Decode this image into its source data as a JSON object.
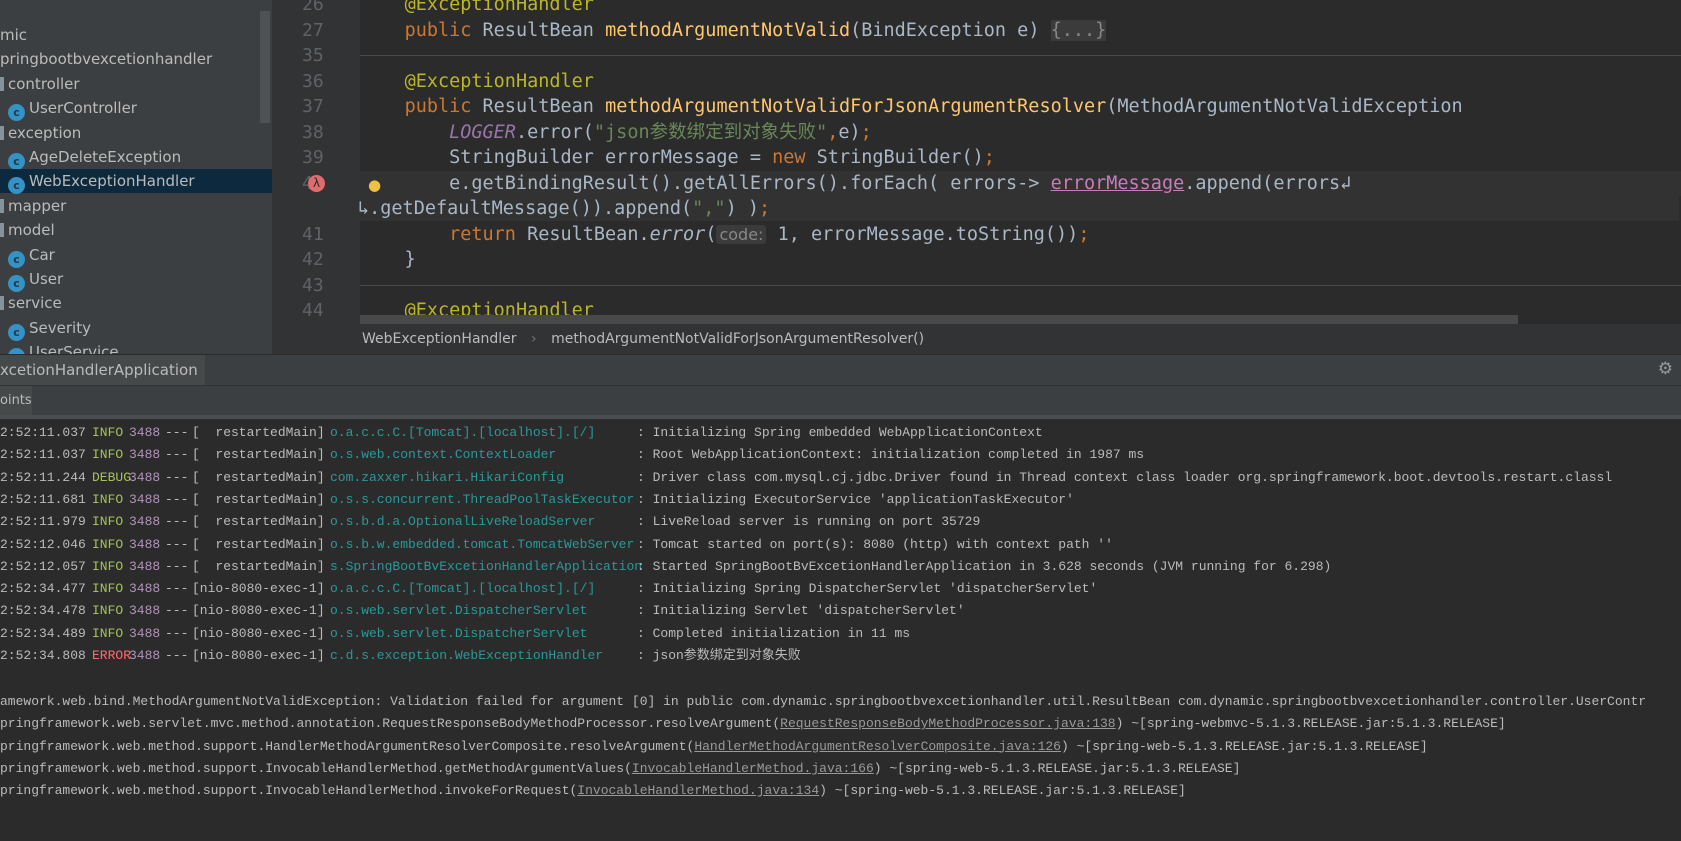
{
  "project_tree": [
    {
      "label": "mic",
      "type": "pkg",
      "indent": 0
    },
    {
      "label": "pringbootbvexcetionhandler",
      "type": "pkg",
      "indent": 0
    },
    {
      "label": "controller",
      "type": "folder",
      "indent": 0
    },
    {
      "label": "UserController",
      "type": "class",
      "indent": 1
    },
    {
      "label": "exception",
      "type": "folder",
      "indent": 0
    },
    {
      "label": "AgeDeleteException",
      "type": "class",
      "indent": 1
    },
    {
      "label": "WebExceptionHandler",
      "type": "class",
      "indent": 1,
      "selected": true
    },
    {
      "label": "mapper",
      "type": "folder",
      "indent": 0
    },
    {
      "label": "model",
      "type": "folder",
      "indent": 0
    },
    {
      "label": "Car",
      "type": "class",
      "indent": 1
    },
    {
      "label": "User",
      "type": "class",
      "indent": 1
    },
    {
      "label": "service",
      "type": "folder",
      "indent": 0
    },
    {
      "label": "Severity",
      "type": "class",
      "indent": 1
    },
    {
      "label": "UserService",
      "type": "class",
      "indent": 1
    }
  ],
  "editor": {
    "lines": [
      {
        "n": "26",
        "tokens": [
          [
            "    "
          ],
          [
            "@ExceptionHandler",
            "an"
          ]
        ]
      },
      {
        "n": "27",
        "tokens": [
          [
            "    "
          ],
          [
            "public ",
            "kw"
          ],
          [
            "ResultBean "
          ],
          [
            "methodArgumentNotValid",
            "fn"
          ],
          [
            "(BindException e) "
          ],
          [
            "{...}",
            "fold"
          ]
        ]
      },
      {
        "n": "35",
        "tokens": [],
        "sep": true
      },
      {
        "n": "36",
        "tokens": [
          [
            "    "
          ],
          [
            "@ExceptionHandler",
            "an"
          ]
        ]
      },
      {
        "n": "37",
        "tokens": [
          [
            "    "
          ],
          [
            "public ",
            "kw"
          ],
          [
            "ResultBean "
          ],
          [
            "methodArgumentNotValidForJsonArgumentResolver",
            "fn"
          ],
          [
            "(MethodArgumentNotValidException"
          ]
        ]
      },
      {
        "n": "38",
        "tokens": [
          [
            "        "
          ],
          [
            "LOGGER",
            "lg"
          ],
          [
            ".error("
          ],
          [
            "\"json参数绑定到对象失败\"",
            "st"
          ],
          [
            ",",
            "kw"
          ],
          [
            "e)"
          ],
          [
            ";",
            "kw"
          ]
        ]
      },
      {
        "n": "39",
        "tokens": [
          [
            "        StringBuilder errorMessage = "
          ],
          [
            "new ",
            "kw"
          ],
          [
            "StringBuilder()"
          ],
          [
            ";",
            "kw"
          ]
        ]
      },
      {
        "n": "40",
        "tokens": [
          [
            "        e.getBindingResult().getAllErrors().forEach( errors-> "
          ],
          [
            "errorMessage",
            "ul"
          ],
          [
            ".append(errors↲"
          ]
        ],
        "current": true
      },
      {
        "n": "",
        "tokens": [
          [
            "↳.getDefaultMessage()).append("
          ],
          [
            "\",\"",
            "st"
          ],
          [
            ") )"
          ],
          [
            ";",
            "kw"
          ]
        ],
        "current": true,
        "wrap": true
      },
      {
        "n": "41",
        "tokens": [
          [
            "        "
          ],
          [
            "return ",
            "kw"
          ],
          [
            "ResultBean."
          ],
          [
            "error",
            "it"
          ],
          [
            "("
          ],
          [
            "code:",
            "hint"
          ],
          [
            " 1, errorMessage.toString())"
          ],
          [
            ";",
            "kw"
          ]
        ]
      },
      {
        "n": "42",
        "tokens": [
          [
            "    }"
          ]
        ]
      },
      {
        "n": "43",
        "tokens": [],
        "sep": true
      },
      {
        "n": "44",
        "tokens": [
          [
            "    "
          ],
          [
            "@ExceptionHandler",
            "an"
          ]
        ]
      }
    ]
  },
  "breadcrumb": {
    "items": [
      "WebExceptionHandler",
      "methodArgumentNotValidForJsonArgumentResolver()"
    ],
    "separator": "›"
  },
  "run_panel": {
    "tab": "xcetionHandlerApplication",
    "close": "×",
    "subtab": "oints",
    "settings_icon": "gear-icon"
  },
  "console": {
    "lines": [
      {
        "time": "2:52:11.037",
        "level": "INFO",
        "pid": "3488",
        "sep": "---",
        "thread": "[  restartedMain]",
        "logger": "o.a.c.c.C.[Tomcat].[localhost].[/]",
        "msg": ": Initializing Spring embedded WebApplicationContext"
      },
      {
        "time": "2:52:11.037",
        "level": "INFO",
        "pid": "3488",
        "sep": "---",
        "thread": "[  restartedMain]",
        "logger": "o.s.web.context.ContextLoader",
        "msg": ": Root WebApplicationContext: initialization completed in 1987 ms"
      },
      {
        "time": "2:52:11.244",
        "level": "DEBUG",
        "pid": "3488",
        "sep": "---",
        "thread": "[  restartedMain]",
        "logger": "com.zaxxer.hikari.HikariConfig",
        "msg": ": Driver class com.mysql.cj.jdbc.Driver found in Thread context class loader org.springframework.boot.devtools.restart.classl"
      },
      {
        "time": "2:52:11.681",
        "level": "INFO",
        "pid": "3488",
        "sep": "---",
        "thread": "[  restartedMain]",
        "logger": "o.s.s.concurrent.ThreadPoolTaskExecutor",
        "msg": ": Initializing ExecutorService 'applicationTaskExecutor'"
      },
      {
        "time": "2:52:11.979",
        "level": "INFO",
        "pid": "3488",
        "sep": "---",
        "thread": "[  restartedMain]",
        "logger": "o.s.b.d.a.OptionalLiveReloadServer",
        "msg": ": LiveReload server is running on port 35729"
      },
      {
        "time": "2:52:12.046",
        "level": "INFO",
        "pid": "3488",
        "sep": "---",
        "thread": "[  restartedMain]",
        "logger": "o.s.b.w.embedded.tomcat.TomcatWebServer",
        "msg": ": Tomcat started on port(s): 8080 (http) with context path ''"
      },
      {
        "time": "2:52:12.057",
        "level": "INFO",
        "pid": "3488",
        "sep": "---",
        "thread": "[  restartedMain]",
        "logger": "s.SpringBootBvExcetionHandlerApplication",
        "msg": ": Started SpringBootBvExcetionHandlerApplication in 3.628 seconds (JVM running for 6.298)"
      },
      {
        "time": "2:52:34.477",
        "level": "INFO",
        "pid": "3488",
        "sep": "---",
        "thread": "[nio-8080-exec-1]",
        "logger": "o.a.c.c.C.[Tomcat].[localhost].[/]",
        "msg": ": Initializing Spring DispatcherServlet 'dispatcherServlet'"
      },
      {
        "time": "2:52:34.478",
        "level": "INFO",
        "pid": "3488",
        "sep": "---",
        "thread": "[nio-8080-exec-1]",
        "logger": "o.s.web.servlet.DispatcherServlet",
        "msg": ": Initializing Servlet 'dispatcherServlet'"
      },
      {
        "time": "2:52:34.489",
        "level": "INFO",
        "pid": "3488",
        "sep": "---",
        "thread": "[nio-8080-exec-1]",
        "logger": "o.s.web.servlet.DispatcherServlet",
        "msg": ": Completed initialization in 11 ms"
      },
      {
        "time": "2:52:34.808",
        "level": "ERROR",
        "pid": "3488",
        "sep": "---",
        "thread": "[nio-8080-exec-1]",
        "logger": "c.d.s.exception.WebExceptionHandler",
        "msg": ": json参数绑定到对象失败"
      }
    ],
    "trace": [
      {
        "pre": "amework.web.bind.MethodArgumentNotValidException: Validation failed for argument [0] in public com.dynamic.springbootbvexcetionhandler.util.ResultBean com.dynamic.springbootbvexcetionhandler.controller.UserContr",
        "link": "",
        "post": ""
      },
      {
        "pre": "pringframework.web.servlet.mvc.method.annotation.RequestResponseBodyMethodProcessor.resolveArgument(",
        "link": "RequestResponseBodyMethodProcessor.java:138",
        "post": ") ~[spring-webmvc-5.1.3.RELEASE.jar:5.1.3.RELEASE]"
      },
      {
        "pre": "pringframework.web.method.support.HandlerMethodArgumentResolverComposite.resolveArgument(",
        "link": "HandlerMethodArgumentResolverComposite.java:126",
        "post": ") ~[spring-web-5.1.3.RELEASE.jar:5.1.3.RELEASE]"
      },
      {
        "pre": "pringframework.web.method.support.InvocableHandlerMethod.getMethodArgumentValues(",
        "link": "InvocableHandlerMethod.java:166",
        "post": ") ~[spring-web-5.1.3.RELEASE.jar:5.1.3.RELEASE]"
      },
      {
        "pre": "pringframework.web.method.support.InvocableHandlerMethod.invokeForRequest(",
        "link": "InvocableHandlerMethod.java:134",
        "post": ") ~[spring-web-5.1.3.RELEASE.jar:5.1.3.RELEASE]"
      }
    ]
  }
}
